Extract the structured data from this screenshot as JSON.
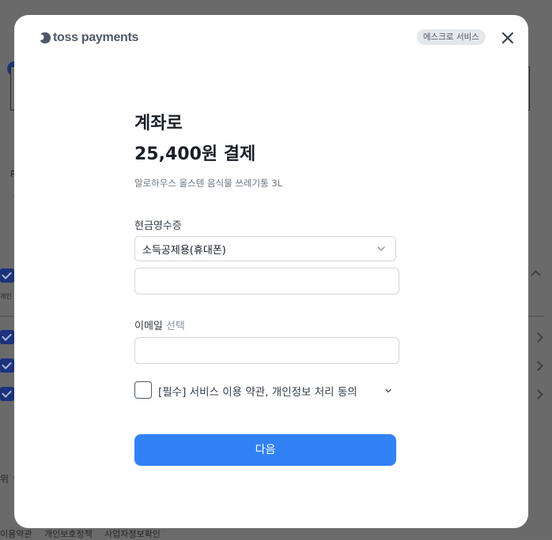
{
  "background_page": {
    "texts": [
      "P",
      "ㅅ",
      "개인",
      "위 ㅎ",
      "이용약관",
      "개인보호정책",
      "사업자정보확인"
    ]
  },
  "header": {
    "logo_text": "toss payments",
    "escrow_badge": "에스크로 서비스",
    "close_icon": "close-icon"
  },
  "payment": {
    "title_line1": "계좌로",
    "title_line2": "25,400원 결제",
    "product_name": "알로하우스 올스텐 음식물 쓰레기통 3L"
  },
  "cash_receipt": {
    "label": "현금영수증",
    "selected_option": "소득공제용(휴대폰)",
    "phone_value": "",
    "phone_placeholder": ""
  },
  "email": {
    "label": "이메일",
    "optional_label": "선택",
    "value": "",
    "placeholder": ""
  },
  "agreement": {
    "text": "[필수] 서비스 이용 약관, 개인정보 처리 동의",
    "checked": false
  },
  "actions": {
    "next_label": "다음"
  },
  "colors": {
    "primary": "#3182f6",
    "title": "#191f28",
    "badge_bg": "#e5e8eb",
    "overlay": "#6b6b6b"
  }
}
